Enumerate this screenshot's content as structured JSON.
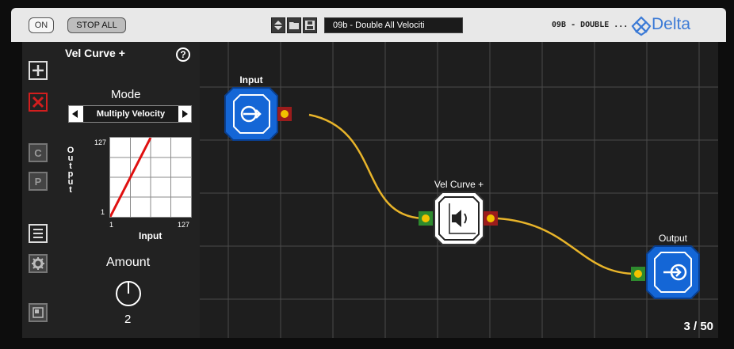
{
  "topbar": {
    "on_label": "ON",
    "stop_all_label": "STOP ALL",
    "preset_name": "09b - Double All Velociti",
    "brand_tag": "09B - DOUBLE ...",
    "brand_name": "Delta",
    "brand_color": "#3b7ad6"
  },
  "props": {
    "title": "Vel Curve +",
    "help": "?",
    "mode_label": "Mode",
    "mode_value": "Multiply Velocity",
    "y_label_letters": [
      "O",
      "u",
      "t",
      "p",
      "u",
      "t"
    ],
    "y_max": "127",
    "y_min": "1",
    "x_min": "1",
    "x_max": "127",
    "x_label": "Input",
    "amount_label": "Amount",
    "amount_value": "2"
  },
  "nodes": {
    "input_label": "Input",
    "vel_curve_label": "Vel Curve +",
    "output_label": "Output"
  },
  "page_counter": "3 / 50",
  "colors": {
    "node_blue": "#1466d6",
    "cable": "#e8b42a",
    "curve_line": "#e01010"
  }
}
